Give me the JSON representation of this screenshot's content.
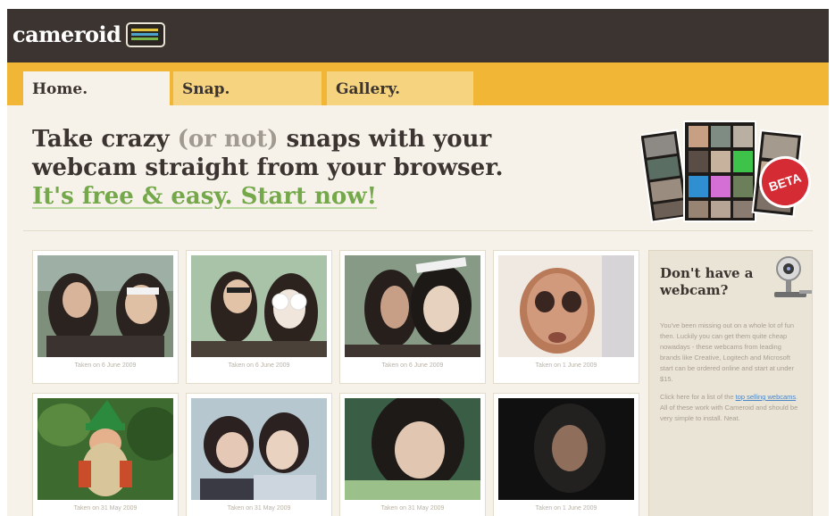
{
  "header": {
    "logo_text": "cameroid",
    "logo_icon": "tv-icon"
  },
  "tabs": [
    {
      "label": "Home.",
      "active": true
    },
    {
      "label": "Snap.",
      "active": false
    },
    {
      "label": "Gallery.",
      "active": false
    }
  ],
  "hero": {
    "line1_pre": "Take crazy ",
    "line1_muted": "(or not)",
    "line1_post": " snaps with your",
    "line2": "webcam straight from your browser.",
    "cta": "It's free & easy. Start now!"
  },
  "badge": {
    "label": "BETA"
  },
  "gallery": {
    "items": [
      {
        "caption": "Taken on 6 June 2009",
        "palette": [
          "#6f7f6c",
          "#2b2320",
          "#e0c0a5"
        ]
      },
      {
        "caption": "Taken on 6 June 2009",
        "palette": [
          "#a9c3a8",
          "#2c231f",
          "#f0e6dc"
        ]
      },
      {
        "caption": "Taken on 6 June 2009",
        "palette": [
          "#879a86",
          "#271f1c",
          "#e7d1bf"
        ]
      },
      {
        "caption": "Taken on 1 June 2009",
        "palette": [
          "#f0e9e2",
          "#b87a58",
          "#d29a7c"
        ]
      },
      {
        "caption": "Taken on 31 May 2009",
        "palette": [
          "#3d6b2f",
          "#c94d2b",
          "#2c8a3e"
        ]
      },
      {
        "caption": "Taken on 31 May 2009",
        "palette": [
          "#b7c7d0",
          "#2a2120",
          "#e5c9b6"
        ]
      },
      {
        "caption": "Taken on 31 May 2009",
        "palette": [
          "#3a5e45",
          "#1e1a18",
          "#e1c7b2"
        ]
      },
      {
        "caption": "Taken on 1 June 2009",
        "palette": [
          "#101010",
          "#232020",
          "#8f6e5b"
        ]
      }
    ]
  },
  "sidebar": {
    "title": "Don't have a webcam?",
    "para1": "You've been missing out on a whole lot of fun then. Luckily you can get them quite cheap nowadays - these webcams from leading brands like Creative, Logitech and Microsoft start can be ordered online and start at under $15.",
    "para2_pre": "Click here for a list of the ",
    "para2_link": "top selling webcams",
    "para2_post": ". All of these work with Cameroid and should be very simple to install. Neat."
  },
  "colors": {
    "header_bg": "#3b3430",
    "tab_bar": "#f2b637",
    "accent_green": "#74a84a",
    "beta_red": "#d52b35"
  }
}
